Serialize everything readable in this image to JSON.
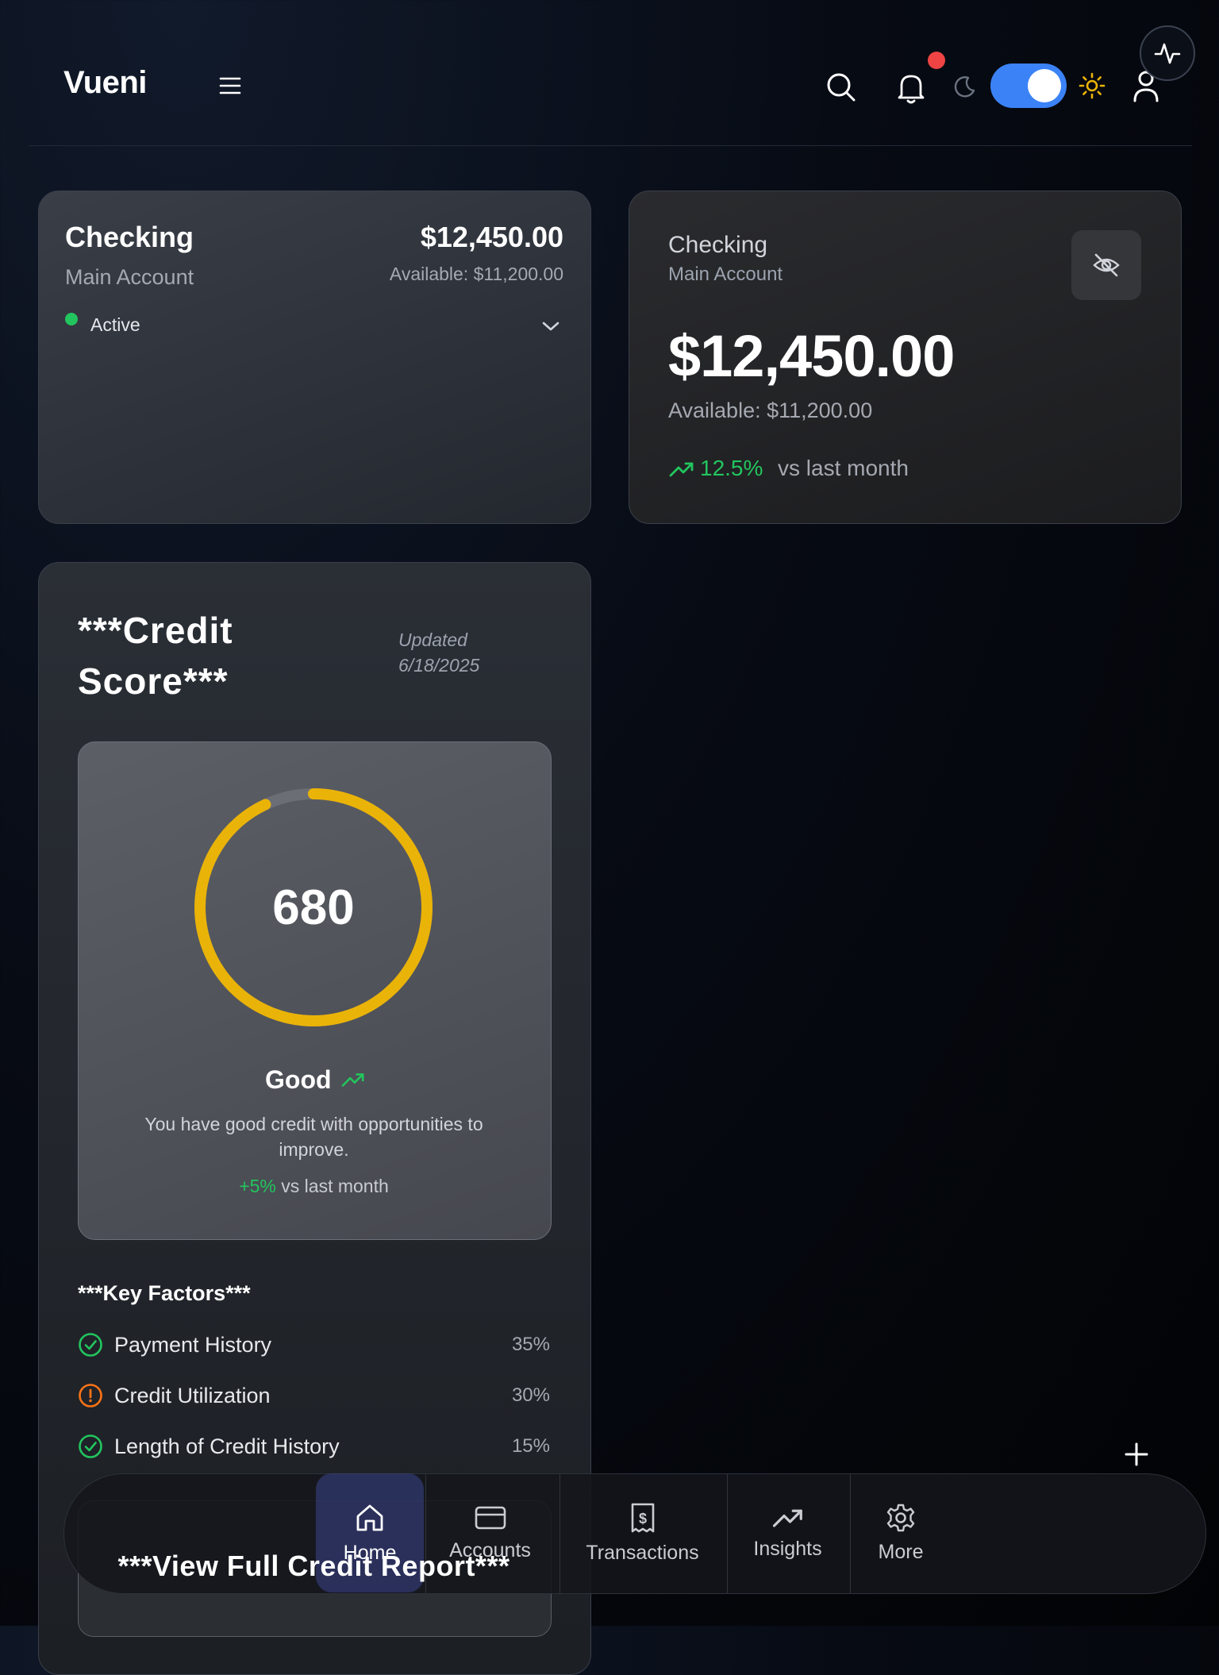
{
  "header": {
    "logo": "Vueni",
    "icons": [
      "menu-icon",
      "search-icon",
      "bell-icon",
      "moon-icon",
      "sun-icon",
      "user-icon",
      "activity-icon"
    ],
    "notification_dot_color": "#ef4444",
    "theme_toggle_on": true
  },
  "account_summary": {
    "title": "Checking",
    "subtitle": "Main Account",
    "balance": "$12,450.00",
    "available": "Available: $11,200.00",
    "status": "Active"
  },
  "account_detail": {
    "title": "Checking",
    "subtitle": "Main Account",
    "balance": "$12,450.00",
    "available": "Available: $11,200.00",
    "change": "12.5%",
    "change_suffix": "vs last month"
  },
  "credit": {
    "title_line1": "***Credit",
    "title_line2": "Score***",
    "updated_line1": "Updated",
    "updated_line2": "6/18/2025",
    "score": "680",
    "score_fraction": 0.93,
    "rating": "Good",
    "description_line1": "You have good credit with opportunities to",
    "description_line2": "improve.",
    "change": "+5%",
    "change_suffix": "vs last month",
    "factors_title": "***Key Factors***",
    "factors": [
      {
        "label": "Payment History",
        "value": "35%",
        "status": "good"
      },
      {
        "label": "Credit Utilization",
        "value": "30%",
        "status": "warning"
      },
      {
        "label": "Length of Credit History",
        "value": "15%",
        "status": "good"
      }
    ],
    "report_button": "***View Full Credit Report***"
  },
  "nav": {
    "items": [
      {
        "label": "Home",
        "icon": "home-icon",
        "active": true
      },
      {
        "label": "Accounts",
        "icon": "card-icon"
      },
      {
        "label": "Transactions",
        "icon": "receipt-icon"
      },
      {
        "label": "Insights",
        "icon": "trending-up-icon"
      },
      {
        "label": "More",
        "icon": "gear-icon"
      }
    ],
    "fab_icon": "plus-icon"
  },
  "colors": {
    "accent": "#3b82f6",
    "positive": "#22c55e",
    "gauge": "#eab308",
    "warning": "#f97316"
  }
}
